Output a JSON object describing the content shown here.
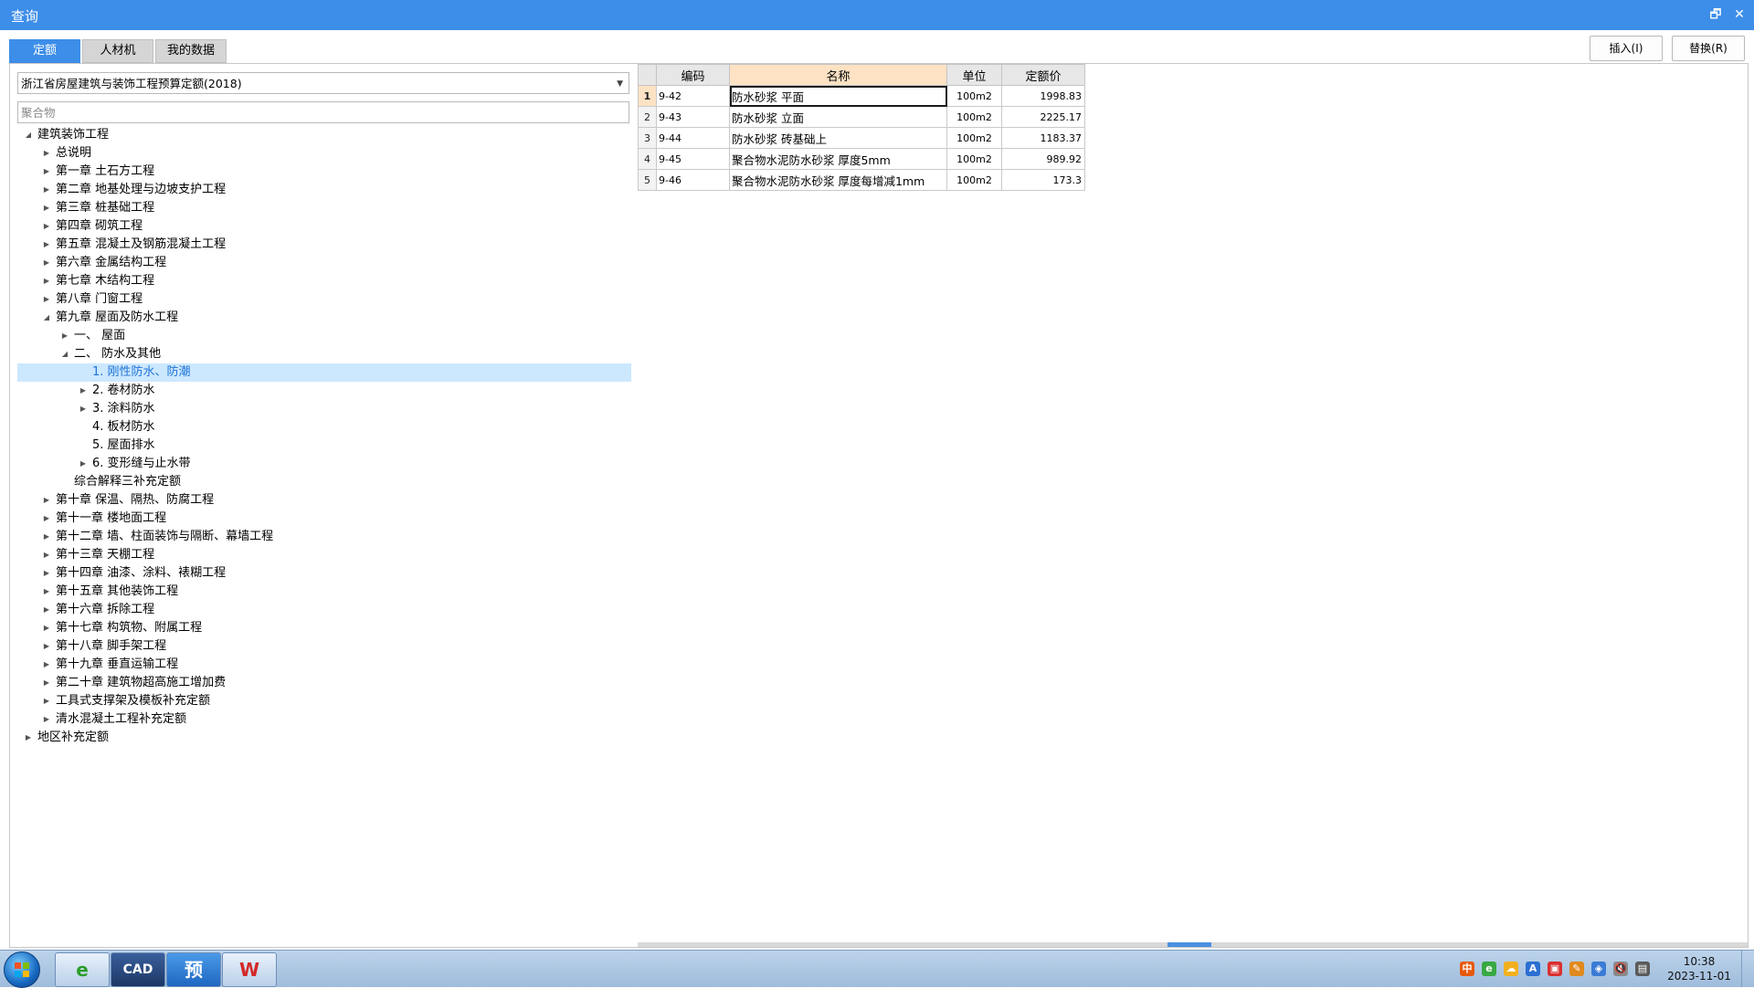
{
  "window": {
    "title": "查询",
    "restore_glyph": "🗗",
    "close_glyph": "✕"
  },
  "tabs": [
    {
      "label": "定额",
      "active": true
    },
    {
      "label": "人材机",
      "active": false
    },
    {
      "label": "我的数据",
      "active": false
    }
  ],
  "actions": {
    "insert_label": "插入(I)",
    "replace_label": "替换(R)"
  },
  "library": {
    "selected": "浙江省房屋建筑与装饰工程预算定额(2018)"
  },
  "search": {
    "value": "",
    "placeholder": "聚合物"
  },
  "tree": [
    {
      "label": "建筑装饰工程",
      "level": 0,
      "state": "expanded"
    },
    {
      "label": "总说明",
      "level": 1,
      "state": "collapsed"
    },
    {
      "label": "第一章 土石方工程",
      "level": 1,
      "state": "collapsed"
    },
    {
      "label": "第二章 地基处理与边坡支护工程",
      "level": 1,
      "state": "collapsed"
    },
    {
      "label": "第三章 桩基础工程",
      "level": 1,
      "state": "collapsed"
    },
    {
      "label": "第四章 砌筑工程",
      "level": 1,
      "state": "collapsed"
    },
    {
      "label": "第五章 混凝土及钢筋混凝土工程",
      "level": 1,
      "state": "collapsed"
    },
    {
      "label": "第六章 金属结构工程",
      "level": 1,
      "state": "collapsed"
    },
    {
      "label": "第七章 木结构工程",
      "level": 1,
      "state": "collapsed"
    },
    {
      "label": "第八章 门窗工程",
      "level": 1,
      "state": "collapsed"
    },
    {
      "label": "第九章 屋面及防水工程",
      "level": 1,
      "state": "expanded"
    },
    {
      "label": "一、 屋面",
      "level": 2,
      "state": "collapsed"
    },
    {
      "label": "二、 防水及其他",
      "level": 2,
      "state": "expanded"
    },
    {
      "label": "1.  刚性防水、防潮",
      "level": 3,
      "state": "leaf",
      "selected": true
    },
    {
      "label": "2.  卷材防水",
      "level": 3,
      "state": "collapsed"
    },
    {
      "label": "3.  涂料防水",
      "level": 3,
      "state": "collapsed"
    },
    {
      "label": "4.  板材防水",
      "level": 3,
      "state": "leaf"
    },
    {
      "label": "5.  屋面排水",
      "level": 3,
      "state": "leaf"
    },
    {
      "label": "6.  变形缝与止水带",
      "level": 3,
      "state": "collapsed"
    },
    {
      "label": "综合解释三补充定额",
      "level": 2,
      "state": "leaf"
    },
    {
      "label": "第十章 保温、隔热、防腐工程",
      "level": 1,
      "state": "collapsed"
    },
    {
      "label": "第十一章 楼地面工程",
      "level": 1,
      "state": "collapsed"
    },
    {
      "label": "第十二章 墙、柱面装饰与隔断、幕墙工程",
      "level": 1,
      "state": "collapsed"
    },
    {
      "label": "第十三章 天棚工程",
      "level": 1,
      "state": "collapsed"
    },
    {
      "label": "第十四章 油漆、涂料、裱糊工程",
      "level": 1,
      "state": "collapsed"
    },
    {
      "label": "第十五章 其他装饰工程",
      "level": 1,
      "state": "collapsed"
    },
    {
      "label": "第十六章 拆除工程",
      "level": 1,
      "state": "collapsed"
    },
    {
      "label": "第十七章 构筑物、附属工程",
      "level": 1,
      "state": "collapsed"
    },
    {
      "label": "第十八章 脚手架工程",
      "level": 1,
      "state": "collapsed"
    },
    {
      "label": "第十九章 垂直运输工程",
      "level": 1,
      "state": "collapsed"
    },
    {
      "label": "第二十章 建筑物超高施工增加费",
      "level": 1,
      "state": "collapsed"
    },
    {
      "label": "工具式支撑架及模板补充定额",
      "level": 1,
      "state": "collapsed"
    },
    {
      "label": "清水混凝土工程补充定额",
      "level": 1,
      "state": "collapsed"
    },
    {
      "label": "地区补充定额",
      "level": 0,
      "state": "collapsed"
    }
  ],
  "grid": {
    "columns": [
      "编码",
      "名称",
      "单位",
      "定额价"
    ],
    "rows": [
      {
        "num": "1",
        "code": "9-42",
        "name": "防水砂浆 平面",
        "unit": "100m2",
        "price": "1998.83"
      },
      {
        "num": "2",
        "code": "9-43",
        "name": "防水砂浆 立面",
        "unit": "100m2",
        "price": "2225.17"
      },
      {
        "num": "3",
        "code": "9-44",
        "name": "防水砂浆 砖基础上",
        "unit": "100m2",
        "price": "1183.37"
      },
      {
        "num": "4",
        "code": "9-45",
        "name": "聚合物水泥防水砂浆 厚度5mm",
        "unit": "100m2",
        "price": "989.92"
      },
      {
        "num": "5",
        "code": "9-46",
        "name": "聚合物水泥防水砂浆 厚度每增减1mm",
        "unit": "100m2",
        "price": "173.3"
      }
    ]
  },
  "taskbar": {
    "apps": [
      {
        "name": "browser",
        "glyph": "e"
      },
      {
        "name": "cad",
        "glyph": "CAD"
      },
      {
        "name": "yu",
        "glyph": "预"
      },
      {
        "name": "wps",
        "glyph": "W"
      }
    ],
    "tray": [
      "中",
      "e",
      "☁",
      "A",
      "▣",
      "✎",
      "◈",
      "🔇",
      "▤"
    ],
    "time": "10:38",
    "date": "2023-11-01"
  },
  "colors": {
    "accent": "#3d8ee9",
    "selected_row": "#cce8ff",
    "header_sorted": "#fde2c4"
  }
}
